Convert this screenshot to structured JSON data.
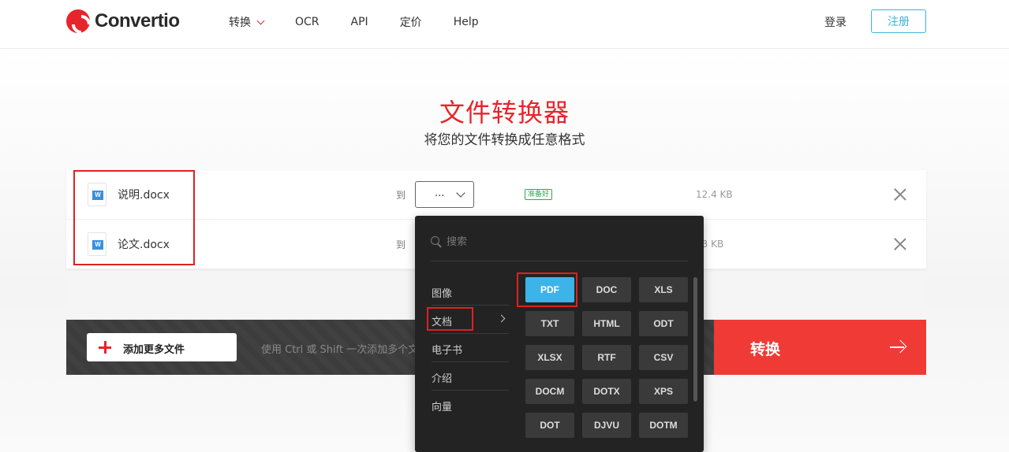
{
  "header": {
    "logo_text": "Convertio",
    "nav": [
      "转换",
      "OCR",
      "API",
      "定价",
      "Help"
    ],
    "login": "登录",
    "register": "注册"
  },
  "hero": {
    "title": "文件转换器",
    "subtitle": "将您的文件转换成任意格式"
  },
  "files": [
    {
      "name": "说明.docx",
      "to_label": "到",
      "format": "...",
      "status": "准备好",
      "size": "12.4 KB"
    },
    {
      "name": "论文.docx",
      "to_label": "到",
      "size": "83 KB"
    }
  ],
  "bottom": {
    "add_more": "添加更多文件",
    "hint": "使用 Ctrl 或 Shift 一次添加多个文件",
    "convert": "转换"
  },
  "dropdown": {
    "search_placeholder": "搜索",
    "categories": [
      "图像",
      "文档",
      "电子书",
      "介绍",
      "向量"
    ],
    "selected_category": "文档",
    "formats": [
      "PDF",
      "DOC",
      "XLS",
      "TXT",
      "HTML",
      "ODT",
      "XLSX",
      "RTF",
      "CSV",
      "DOCM",
      "DOTX",
      "XPS",
      "DOT",
      "DJVU",
      "DOTM"
    ],
    "selected_format": "PDF"
  },
  "colors": {
    "brand_red": "#e8242b",
    "convert_red": "#f03a35",
    "accent_blue": "#3cb4e8",
    "annotation_red": "#e02020"
  }
}
